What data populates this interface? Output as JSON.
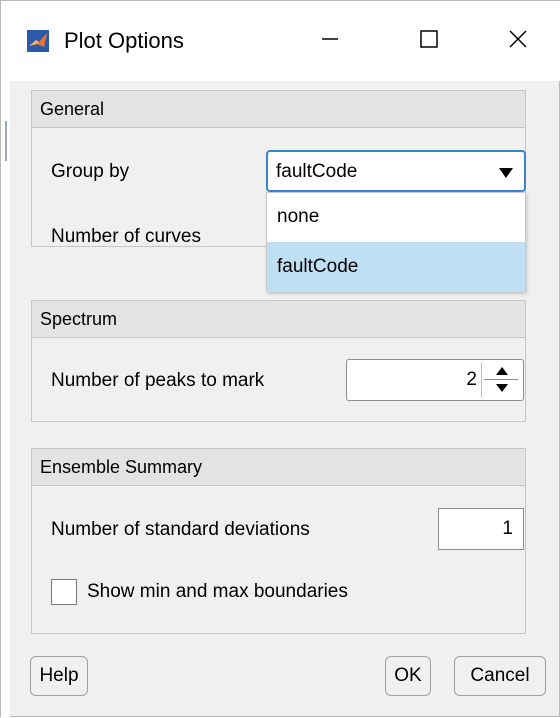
{
  "window": {
    "title": "Plot Options",
    "icon": "matlab-logo-icon",
    "controls": [
      "minimize-icon",
      "maximize-icon",
      "close-icon"
    ]
  },
  "general": {
    "header": "General",
    "group_by_label": "Group by",
    "group_by_value": "faultCode",
    "group_by_options": [
      "none",
      "faultCode"
    ],
    "group_by_highlighted": "faultCode",
    "number_of_curves_label": "Number of curves"
  },
  "spectrum": {
    "header": "Spectrum",
    "peaks_label": "Number of peaks to mark",
    "peaks_value": "2"
  },
  "ensemble": {
    "header": "Ensemble Summary",
    "std_label": "Number of standard deviations",
    "std_value": "1",
    "minmax_label": "Show min and max boundaries",
    "minmax_checked": false
  },
  "buttons": {
    "help": "Help",
    "ok": "OK",
    "cancel": "Cancel"
  },
  "colors": {
    "focus_border": "#3c82d6",
    "selected_option_bg": "#bfe0f4",
    "panel_header_bg": "#e3e3e3",
    "dialog_bg": "#f0f0f0"
  }
}
